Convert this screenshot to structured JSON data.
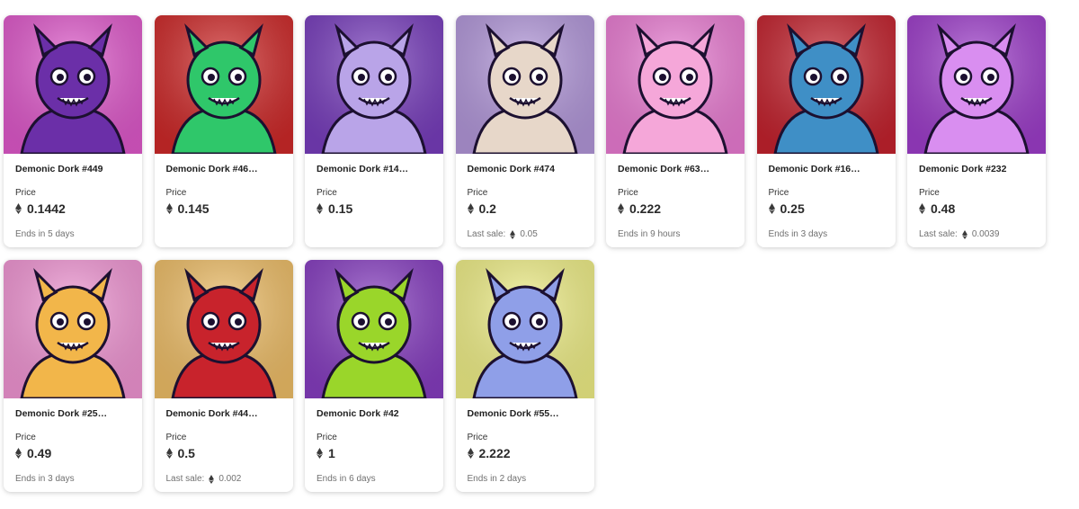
{
  "price_label": "Price",
  "last_sale_label": "Last sale:",
  "cards": [
    {
      "name": "Demonic Dork #449",
      "price": "0.1442",
      "footer": "Ends in 5 days",
      "footer_type": "ends",
      "last_sale": "",
      "bg": "#e55bd0",
      "fg": "#6b2fa8",
      "icon": "purple-bat-demon"
    },
    {
      "name": "Demonic Dork #46…",
      "price": "0.145",
      "footer": "",
      "footer_type": "none",
      "last_sale": "",
      "bg": "#d42a2a",
      "fg": "#2fc76a",
      "icon": "green-lizard-monster"
    },
    {
      "name": "Demonic Dork #14…",
      "price": "0.15",
      "footer": "",
      "footer_type": "none",
      "last_sale": "",
      "bg": "#7b3fc2",
      "fg": "#b9a4e8",
      "icon": "mouth-head-monster"
    },
    {
      "name": "Demonic Dork #474",
      "price": "0.2",
      "footer": "",
      "footer_type": "sale",
      "last_sale": "0.05",
      "bg": "#b79be0",
      "fg": "#e7d7c9",
      "icon": "astronaut-cookie"
    },
    {
      "name": "Demonic Dork #63…",
      "price": "0.222",
      "footer": "Ends in 9 hours",
      "footer_type": "ends",
      "last_sale": "",
      "bg": "#f07fd8",
      "fg": "#f5a7d9",
      "icon": "pink-dork-beanie"
    },
    {
      "name": "Demonic Dork #16…",
      "price": "0.25",
      "footer": "Ends in 3 days",
      "footer_type": "ends",
      "last_sale": "",
      "bg": "#c9232f",
      "fg": "#3f8fc6",
      "icon": "blue-skull-cap"
    },
    {
      "name": "Demonic Dork #232",
      "price": "0.48",
      "footer": "",
      "footer_type": "sale",
      "last_sale": "0.0039",
      "bg": "#a23fd0",
      "fg": "#d98ef0",
      "icon": "many-eyed-octopus"
    },
    {
      "name": "Demonic Dork #25…",
      "price": "0.49",
      "footer": "Ends in 3 days",
      "footer_type": "ends",
      "last_sale": "",
      "bg": "#f799d9",
      "fg": "#f2b64a",
      "icon": "golden-king-demon"
    },
    {
      "name": "Demonic Dork #44…",
      "price": "0.5",
      "footer": "",
      "footer_type": "sale",
      "last_sale": "0.002",
      "bg": "#f5c36a",
      "fg": "#c8232c",
      "icon": "oni-samurai"
    },
    {
      "name": "Demonic Dork #42",
      "price": "1",
      "footer": "Ends in 6 days",
      "footer_type": "ends",
      "last_sale": "",
      "bg": "#8a3fc6",
      "fg": "#9ad62a",
      "icon": "green-alien"
    },
    {
      "name": "Demonic Dork #55…",
      "price": "2.222",
      "footer": "Ends in 2 days",
      "footer_type": "ends",
      "last_sale": "",
      "bg": "#f6f58a",
      "fg": "#8f9fe8",
      "icon": "patchwork-bear"
    }
  ]
}
